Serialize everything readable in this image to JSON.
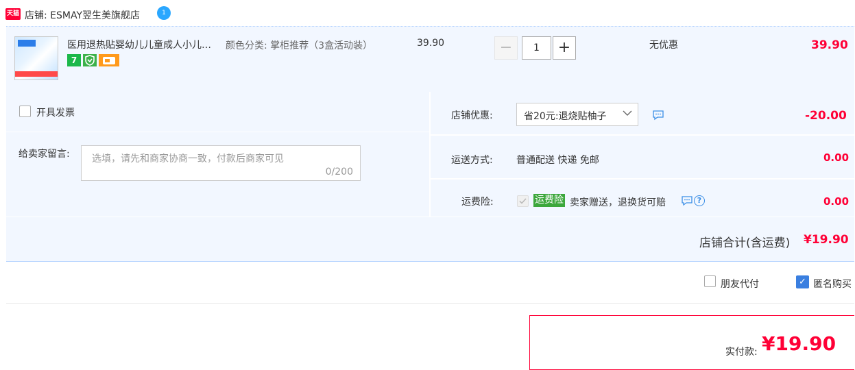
{
  "shop": {
    "badge": "天猫",
    "name": "店铺: ESMAY翌生美旗舰店",
    "wangwang": "1"
  },
  "item": {
    "title": "医用退热贴婴幼儿儿童成人小儿…",
    "badge_7": "7",
    "sku": "颜色分类: 掌柜推荐（3盒活动装）",
    "unit_price": "39.90",
    "quantity": "1",
    "minus": "−",
    "plus": "+",
    "discount": "无优惠",
    "subtotal": "39.90"
  },
  "invoice": {
    "label": "开具发票"
  },
  "memo": {
    "label": "给卖家留言:",
    "placeholder": "选填，请先和商家协商一致，付款后商家可见",
    "count": "0/200"
  },
  "coupon": {
    "label": "店铺优惠:",
    "selected": "省20元:退烧贴柚子",
    "amount": "-20.00"
  },
  "shipping": {
    "label": "运送方式:",
    "value": "普通配送 快递 免邮",
    "amount": "0.00"
  },
  "insurance": {
    "label": "运费险:",
    "tag": "运费险",
    "text": "卖家赠送，退换货可赔",
    "help": "?",
    "amount": "0.00"
  },
  "total": {
    "label": "店铺合计(含运费)",
    "amount": "¥19.90"
  },
  "options": {
    "friend_pay": "朋友代付",
    "anonymous": "匿名购买",
    "anonymous_check": "✓"
  },
  "pay": {
    "label": "实付款:",
    "amount": "¥19.90"
  },
  "colors": {
    "accent_red": "#ff0036",
    "panel_bg": "#f2f7ff",
    "check_blue": "#3a7fe0"
  }
}
